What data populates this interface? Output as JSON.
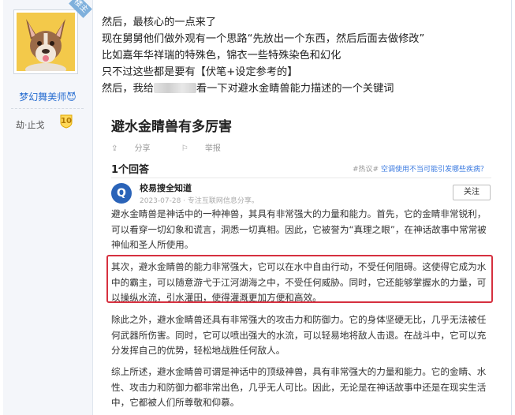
{
  "user": {
    "badge": "楼主",
    "name": "梦幻舞美师",
    "name_emoji": "😈",
    "rank": "劫·止戈",
    "level": "10"
  },
  "post": {
    "lines": [
      "然后，最核心的一点来了",
      "现在舅舅他们做外观有一个思路“先放出一个东西，然后后面去做修改”",
      "比如嘉年华祥瑞的特殊色，锦衣一些特殊染色和幻化",
      "只不过这些都是要有【伏笔+设定参考的】"
    ],
    "last_line_prefix": "然后，我给",
    "last_line_suffix": "看一下对避水金睛兽能力描述的一个关键词"
  },
  "embed": {
    "question_title": "避水金睛兽有多厉害",
    "share": "分享",
    "report": "举报",
    "answers_count": "1个回答",
    "hot_tag": "#热议#",
    "hot_link": "空调使用不当可能引发哪些疾病？",
    "answerer_name": "校易搜全知道",
    "answerer_meta": "2023-07-28 · 专注互联网信息分享。",
    "follow": "关注",
    "paragraphs": [
      "避水金睛兽是神话中的一种神兽，其具有非常强大的力量和能力。首先，它的金睛非常锐利，可以看穿一切幻象和谎言，洞悉一切真相。因此，它被誉为“真理之眼”，在神话故事中常常被神仙和圣人所使用。",
      "其次，避水金睛兽的能力非常强大，它可以在水中自由行动，不受任何阻碍。这使得它成为水中的霸主，可以随意游弋于江河湖海之中，不受任何威胁。同时，它还能够掌握水的力量，可以操纵水流，引水灌田，使得灌溉更加方便和高效。",
      "除此之外，避水金睛兽还具有非常强大的攻击力和防御力。它的身体坚硬无比，几乎无法被任何武器所伤害。同时，它可以喷出强大的水流，可以轻易地将敌人击退。在战斗中，它可以充分发挥自己的优势，轻松地战胜任何敌人。",
      "综上所述，避水金睛兽可谓是神话中的顶级神兽，具有非常强大的力量和能力。它的金睛、水性、攻击力和防御力都非常出色，几乎无人可比。因此，无论是在神话故事中还是在现实生活中，它都被人们所尊敬和仰慕。"
    ]
  },
  "colors": {
    "highlight": "#d6303f",
    "link": "#2a6fd1",
    "sidebar_bg": "#f4f6fa"
  }
}
